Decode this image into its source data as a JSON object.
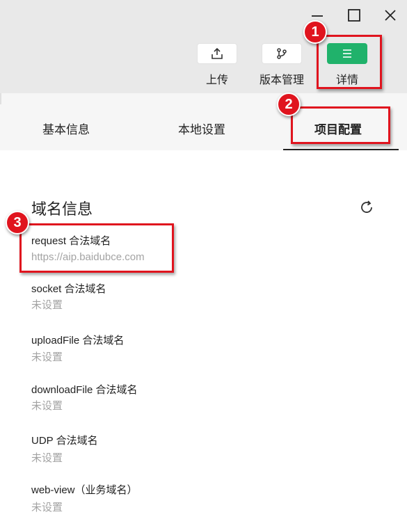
{
  "window_controls": [
    "minimize",
    "maximize",
    "close"
  ],
  "toolbar": {
    "upload_label": "上传",
    "version_label": "版本管理",
    "details_label": "详情"
  },
  "tabs": [
    {
      "label": "基本信息",
      "active": false
    },
    {
      "label": "本地设置",
      "active": false
    },
    {
      "label": "项目配置",
      "active": true
    }
  ],
  "section": {
    "title": "域名信息",
    "entries": [
      {
        "label": "request 合法域名",
        "value": "https://aip.baidubce.com"
      },
      {
        "label": "socket 合法域名",
        "value": "未设置"
      },
      {
        "label": "uploadFile 合法域名",
        "value": "未设置"
      },
      {
        "label": "downloadFile 合法域名",
        "value": "未设置"
      },
      {
        "label": "UDP 合法域名",
        "value": "未设置"
      },
      {
        "label": "web-view（业务域名）",
        "value": "未设置"
      }
    ]
  },
  "annotations": {
    "badge1": "1",
    "badge2": "2",
    "badge3": "3"
  },
  "colors": {
    "accent_green": "#20b26b",
    "annotation_red": "#e0141e",
    "muted_text": "#a3a3a3"
  }
}
